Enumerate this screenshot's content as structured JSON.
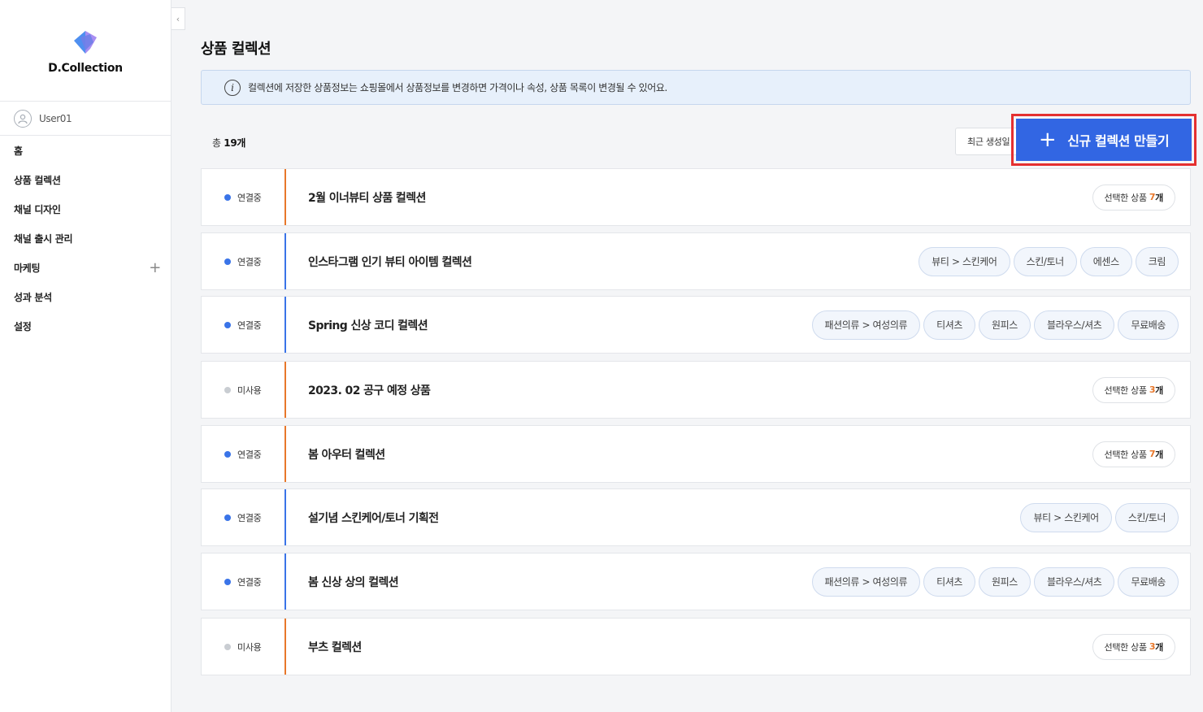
{
  "brand": {
    "name": "D.Collection"
  },
  "user": {
    "name": "User01"
  },
  "nav": [
    {
      "label": "홈"
    },
    {
      "label": "상품 컬렉션"
    },
    {
      "label": "채널 디자인"
    },
    {
      "label": "채널 출시 관리"
    },
    {
      "label": "마케팅",
      "expand": "+"
    },
    {
      "label": "성과 분석"
    },
    {
      "label": "설정"
    }
  ],
  "collapse_glyph": "‹",
  "page": {
    "title": "상품 컬렉션",
    "notice": "컬렉션에 저장한 상품정보는 쇼핑몰에서 상품정보를 변경하면 가격이나 속성, 상품 목록이 변경될 수 있어요.",
    "total_prefix": "총 ",
    "total_count": "19",
    "total_unit": "개",
    "sort_value": "최근 생성일",
    "create_button": "신규 컬렉션 만들기"
  },
  "colors": {
    "accent": "#3266e3",
    "connected": "#3a74e8",
    "unused": "#c9cdd2",
    "orange": "#e8772a",
    "highlight": "#e53030"
  },
  "rows": [
    {
      "status": "연결중",
      "title": "2월 이너뷰티 상품 컬렉션",
      "count_label": "선택한 상품",
      "count": "7",
      "count_unit": "개",
      "tags": []
    },
    {
      "status": "연결중",
      "title": "인스타그램 인기 뷰티 아이템 컬렉션",
      "tags": [
        "뷰티 > 스킨케어",
        "스킨/토너",
        "에센스",
        "크림"
      ]
    },
    {
      "status": "연결중",
      "title": "Spring 신상 코디 컬렉션",
      "tags": [
        "패션의류 > 여성의류",
        "티셔츠",
        "원피스",
        "블라우스/셔츠",
        "무료배송"
      ]
    },
    {
      "status": "미사용",
      "title": "2023. 02 공구 예정 상품",
      "count_label": "선택한 상품",
      "count": "3",
      "count_unit": "개",
      "tags": []
    },
    {
      "status": "연결중",
      "title": "봄 아우터 컬렉션",
      "count_label": "선택한 상품",
      "count": "7",
      "count_unit": "개",
      "tags": []
    },
    {
      "status": "연결중",
      "title": "설기념 스킨케어/토너 기획전",
      "tags": [
        "뷰티 > 스킨케어",
        "스킨/토너"
      ]
    },
    {
      "status": "연결중",
      "title": "봄 신상 상의 컬렉션",
      "tags": [
        "패션의류 > 여성의류",
        "티셔츠",
        "원피스",
        "블라우스/셔츠",
        "무료배송"
      ]
    },
    {
      "status": "미사용",
      "title": "부츠 컬렉션",
      "count_label": "선택한 상품",
      "count": "3",
      "count_unit": "개",
      "tags": []
    }
  ]
}
